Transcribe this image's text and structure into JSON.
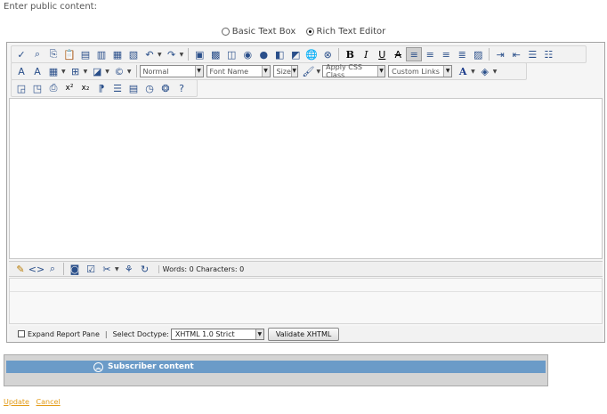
{
  "heading": "Enter public content:",
  "mode": {
    "basic_label": "Basic Text Box",
    "rich_label": "Rich Text Editor",
    "selected": "rich"
  },
  "toolbar": {
    "paragraph_style": "Normal",
    "font_name": "Font Name",
    "font_size": "Size",
    "css_class": "Apply CSS Class",
    "custom_links": "Custom Links"
  },
  "status": {
    "words_chars": "Words: 0 Characters: 0"
  },
  "footer": {
    "expand_report_label": "Expand Report Pane",
    "doctype_label": "Select Doctype:",
    "doctype_value": "XHTML 1.0 Strict",
    "validate_label": "Validate XHTML"
  },
  "subscriber": {
    "title": "Subscriber content"
  },
  "actions": {
    "update": "Update",
    "cancel": "Cancel"
  }
}
